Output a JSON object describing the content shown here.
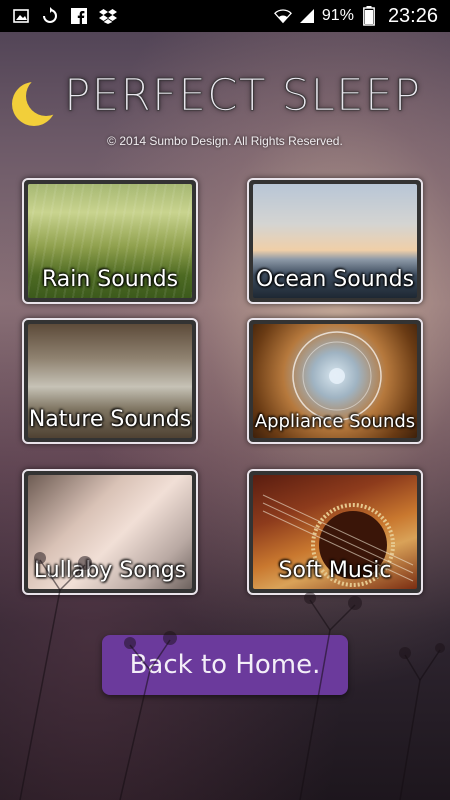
{
  "status_bar": {
    "icons": [
      "image-icon",
      "sync-icon",
      "facebook-icon",
      "dropbox-icon",
      "wifi-icon",
      "signal-icon",
      "battery-icon"
    ],
    "battery_percent": "91%",
    "time": "23:26"
  },
  "header": {
    "title": "PERFECT SLEEP",
    "copyright": "© 2014 Sumbo Design. All Rights Reserved."
  },
  "categories": [
    {
      "label": "Rain Sounds"
    },
    {
      "label": "Ocean Sounds"
    },
    {
      "label": "Nature Sounds"
    },
    {
      "label": "Appliance Sounds"
    },
    {
      "label": "Lullaby Songs"
    },
    {
      "label": "Soft Music"
    }
  ],
  "back_button": {
    "label": "Back to Home."
  },
  "colors": {
    "accent_purple": "#6b3a9c",
    "tile_border": "#e9e3ea",
    "moon_yellow": "#f2cf3a"
  }
}
